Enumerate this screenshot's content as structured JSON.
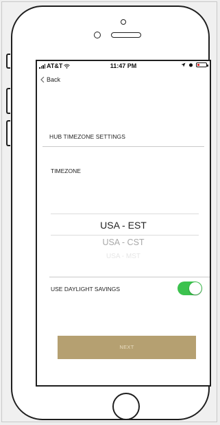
{
  "status_bar": {
    "carrier": "AT&T",
    "time": "11:47 PM"
  },
  "nav": {
    "back_label": "Back"
  },
  "hub_timezone": {
    "section_title": "HUB TIMEZONE SETTINGS",
    "timezone_label": "TIMEZONE",
    "picker_options": [
      "USA - EST",
      "USA - CST",
      "USA - MST"
    ],
    "selected_option": "USA - EST"
  },
  "daylight_savings": {
    "label": "USE DAYLIGHT SAVINGS",
    "enabled": true
  },
  "actions": {
    "next_label": "NEXT"
  },
  "colors": {
    "accent_gold": "#b5a071",
    "toggle_on": "#3cc24e",
    "battery_low": "#e03030"
  }
}
